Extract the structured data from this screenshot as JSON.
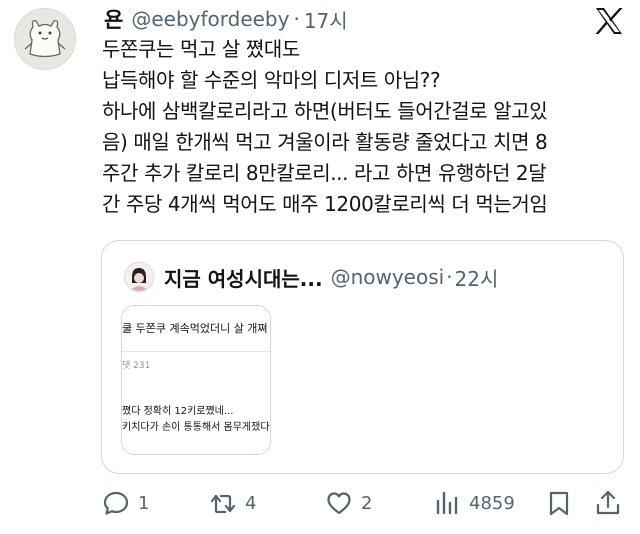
{
  "author": {
    "name": "욘",
    "handle": "@eebyfordeeby",
    "separator": "·",
    "time": "17시"
  },
  "tweet_lines": [
    "두쫀쿠는 먹고 살 쪘대도",
    "납득해야 할 수준의 악마의 디저트 아님??",
    "하나에 삼백칼로리라고 하면(버터도 들어간걸로 알고있",
    "음) 매일 한개씩 먹고 겨울이라 활동량 줄었다고 치면 8",
    "주간 추가 칼로리 8만칼로리... 라고 하면 유행하던 2달",
    "간 주당 4개씩 먹어도 매주 1200칼로리씩 더 먹는거임"
  ],
  "quoted": {
    "name": "지금 여성시대는...",
    "handle": "@nowyeosi",
    "separator": "·",
    "time": "22시",
    "media": {
      "title": "쿨 두쫀쿠 계속먹었더니 살 개쪄",
      "count": "댓 231",
      "line1": "쪘다 정확히 12키로쪘네...",
      "line2": "키치다가 손이 통통해서 몸무게쟀다가"
    }
  },
  "actions": {
    "replies": "1",
    "reposts": "4",
    "likes": "2",
    "views": "4859"
  },
  "icons": [
    "x-logo-icon",
    "reply-icon",
    "repost-icon",
    "like-icon",
    "views-icon",
    "bookmark-icon",
    "share-icon"
  ],
  "colors": {
    "text": "#0f1419",
    "secondary": "#536471",
    "border": "#cfd9de"
  }
}
